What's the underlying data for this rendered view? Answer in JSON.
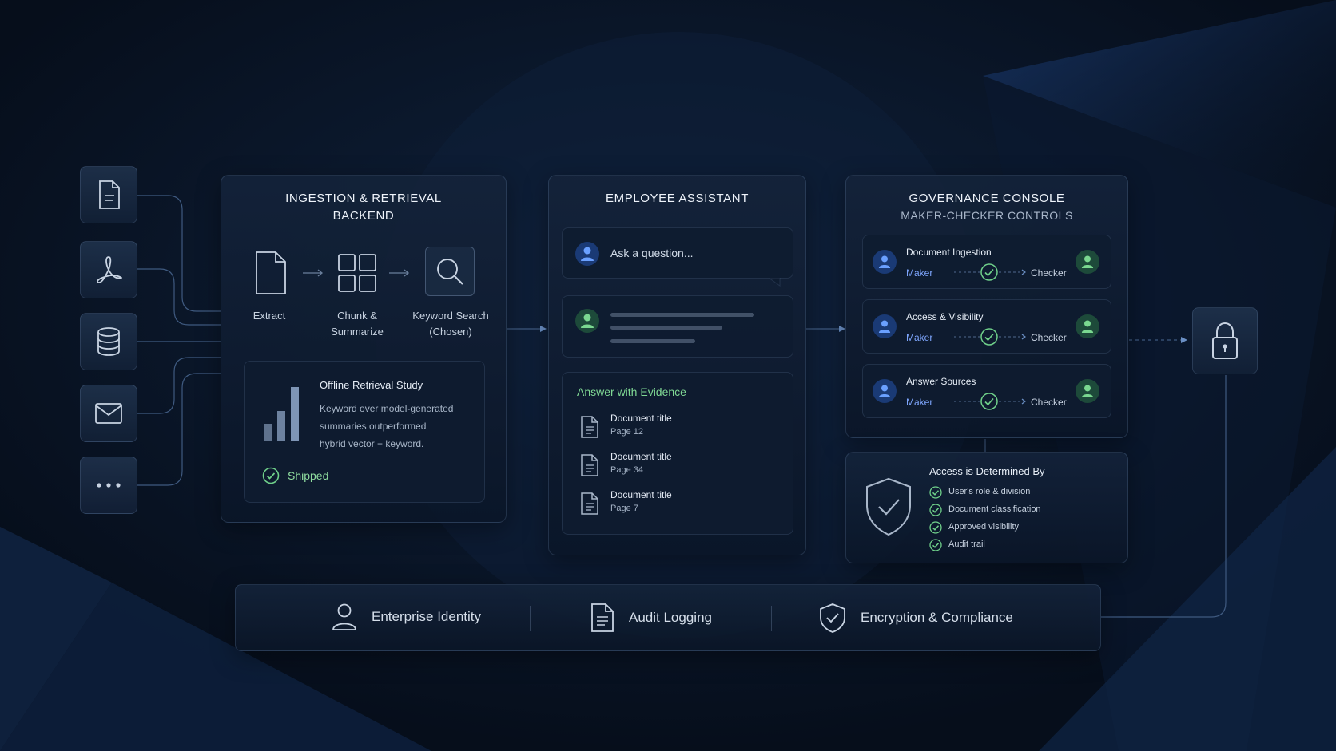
{
  "ingestion": {
    "title_line1": "INGESTION & RETRIEVAL",
    "title_line2": "BACKEND",
    "steps": [
      {
        "label_line1": "Extract",
        "label_line2": ""
      },
      {
        "label_line1": "Chunk &",
        "label_line2": "Summarize"
      },
      {
        "label_line1": "Keyword Search",
        "label_line2": "(Chosen)"
      }
    ],
    "study": {
      "title": "Offline Retrieval Study",
      "body_line1": "Keyword over model-generated",
      "body_line2": "summaries outperformed",
      "body_line3": "hybrid vector + keyword.",
      "status": "Shipped"
    }
  },
  "assistant": {
    "title": "EMPLOYEE ASSISTANT",
    "input_placeholder": "Ask a question...",
    "answer_heading": "Answer with Evidence",
    "documents": [
      {
        "title": "Document title",
        "page": "Page 12"
      },
      {
        "title": "Document title",
        "page": "Page 34"
      },
      {
        "title": "Document title",
        "page": "Page 7"
      }
    ]
  },
  "governance": {
    "title": "GOVERNANCE CONSOLE",
    "subtitle": "MAKER-CHECKER CONTROLS",
    "rows": [
      {
        "name": "Document Ingestion",
        "maker": "Maker",
        "checker": "Checker"
      },
      {
        "name": "Access & Visibility",
        "maker": "Maker",
        "checker": "Checker"
      },
      {
        "name": "Answer Sources",
        "maker": "Maker",
        "checker": "Checker"
      }
    ],
    "access": {
      "heading": "Access is Determined By",
      "items": [
        "User's role & division",
        "Document classification",
        "Approved visibility",
        "Audit trail"
      ]
    }
  },
  "footer": {
    "items": [
      "Enterprise Identity",
      "Audit Logging",
      "Encryption & Compliance"
    ]
  },
  "colors": {
    "accent_green": "#6fd08a",
    "accent_blue": "#4f8df0",
    "maker_blue": "#7fa7ff",
    "line": "#3f5a80"
  },
  "icons": {
    "sources": [
      "document-icon",
      "pdf-icon",
      "database-icon",
      "mail-icon",
      "more-icon"
    ],
    "lock": "lock-icon"
  }
}
